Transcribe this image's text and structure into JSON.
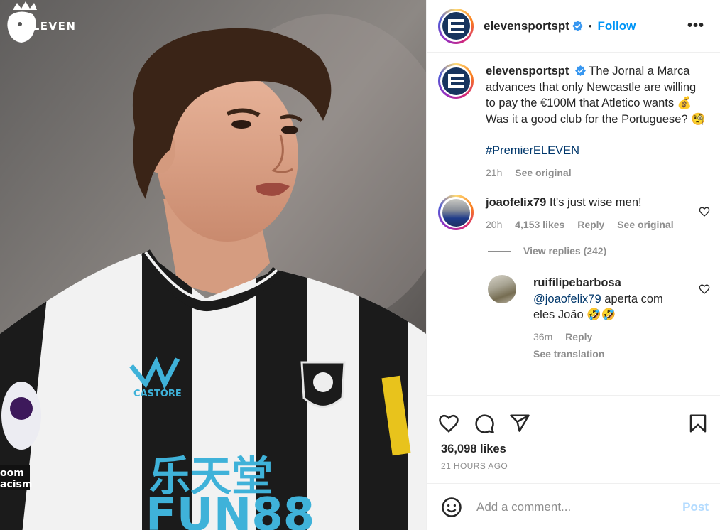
{
  "media": {
    "brand_logo": "ELEVEN",
    "league_logo_text": "Premier League",
    "jersey_sponsor": "乐天堂 FUN88",
    "kit_maker": "CASTORE",
    "kit_badge": "NEWCASTLE UNITED",
    "sleeve_text_1": "oom",
    "sleeve_text_2": "acism"
  },
  "header": {
    "username": "elevensportspt",
    "separator": "•",
    "follow_label": "Follow",
    "more_label": "•••"
  },
  "caption": {
    "username": "elevensportspt",
    "text": "The Jornal a Marca advances that only Newcastle are willing to pay the €100M that Atletico wants 💰 Was it a good club for the Portuguese? 🧐",
    "hashtag": "#PremierELEVEN",
    "time": "21h",
    "see_original": "See original"
  },
  "comment": {
    "username": "joaofelix79",
    "text": "It's just wise men!",
    "time": "20h",
    "likes": "4,153 likes",
    "reply_label": "Reply",
    "see_original": "See original",
    "view_replies": "View replies (242)"
  },
  "reply": {
    "username": "ruifilipebarbosa",
    "mention": "@joaofelix79",
    "text": " aperta com eles João 🤣🤣",
    "time": "36m",
    "reply_label": "Reply",
    "see_translation": "See translation"
  },
  "actions": {
    "likes": "36,098 likes",
    "time_ago": "21 HOURS AGO"
  },
  "composer": {
    "placeholder": "Add a comment...",
    "post_label": "Post"
  },
  "colors": {
    "accent": "#0095f6",
    "post_disabled": "#b3dbff",
    "link": "#00376b",
    "muted": "#8e8e8e"
  }
}
